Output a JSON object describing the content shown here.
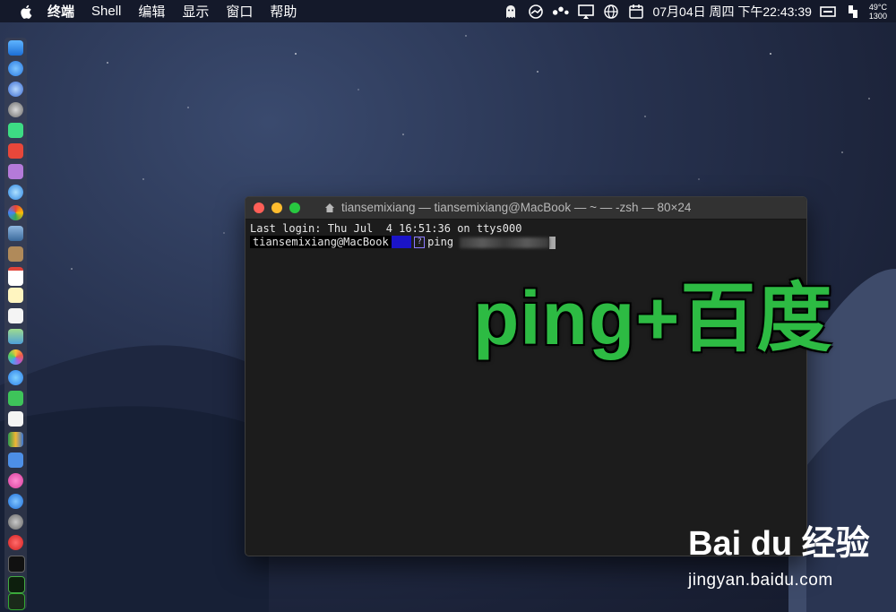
{
  "menubar": {
    "app_name": "终端",
    "menus": [
      "Shell",
      "编辑",
      "显示",
      "窗口",
      "帮助"
    ],
    "clock": "07月04日 周四 下午22:43:39",
    "weather_temp": "49°C",
    "weather_value": "1300"
  },
  "terminal": {
    "title": "tiansemixiang — tiansemixiang@MacBook — ~ — -zsh — 80×24",
    "last_login": "Last login: Thu Jul  4 16:51:36 on ttys000",
    "prompt_user": "tiansemixiang@MacBook",
    "command": "ping "
  },
  "caption": "ping+百度",
  "watermark": {
    "logo": "Bai du 经验",
    "url": "jingyan.baidu.com"
  },
  "colors": {
    "caption": "#2dbb43",
    "close": "#ff5f57",
    "minimize": "#febc2e",
    "maximize": "#28c840"
  }
}
